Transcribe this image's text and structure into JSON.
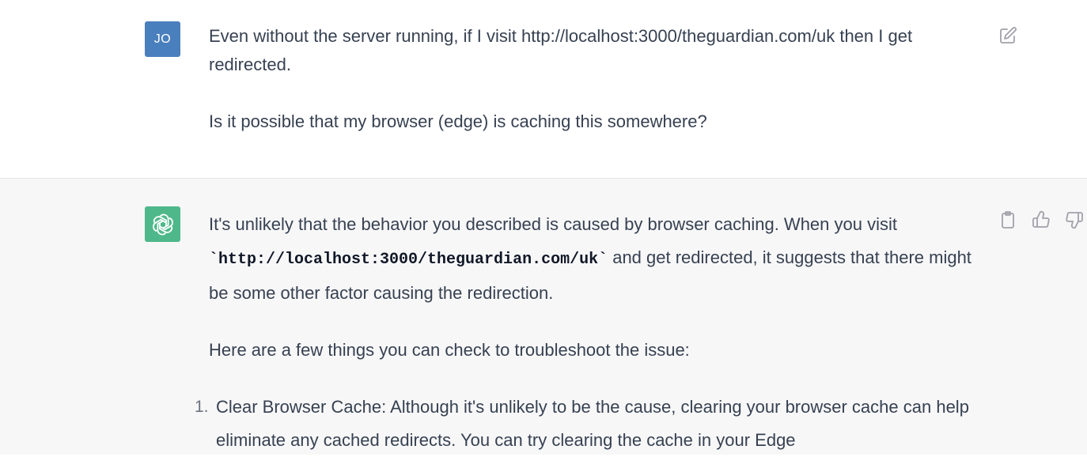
{
  "user_message": {
    "avatar_initials": "JO",
    "paragraphs": [
      "Even without the server running, if I visit http://localhost:3000/theguardian.com/uk then I get redirected.",
      "Is it possible that my browser (edge) is caching this somewhere?"
    ],
    "edit_icon": "edit-icon"
  },
  "assistant_message": {
    "avatar_icon": "openai-logo-icon",
    "intro_part1": "It's unlikely that the behavior you described is caused by browser caching. When you visit ",
    "intro_code": "`http://localhost:3000/theguardian.com/uk`",
    "intro_part2": " and get redirected, it suggests that there might be some other factor causing the redirection.",
    "troubleshoot_heading": "Here are a few things you can check to troubleshoot the issue:",
    "list_items": [
      {
        "number": "1.",
        "text": "Clear Browser Cache: Although it's unlikely to be the cause, clearing your browser cache can help eliminate any cached redirects. You can try clearing the cache in your Edge"
      }
    ],
    "actions": [
      "copy-icon",
      "thumbs-up-icon",
      "thumbs-down-icon"
    ]
  },
  "colors": {
    "user_avatar_bg": "#4a7fbe",
    "bot_avatar_bg": "#4fb88a",
    "assistant_bg": "#f7f7f8",
    "text": "#374151"
  }
}
